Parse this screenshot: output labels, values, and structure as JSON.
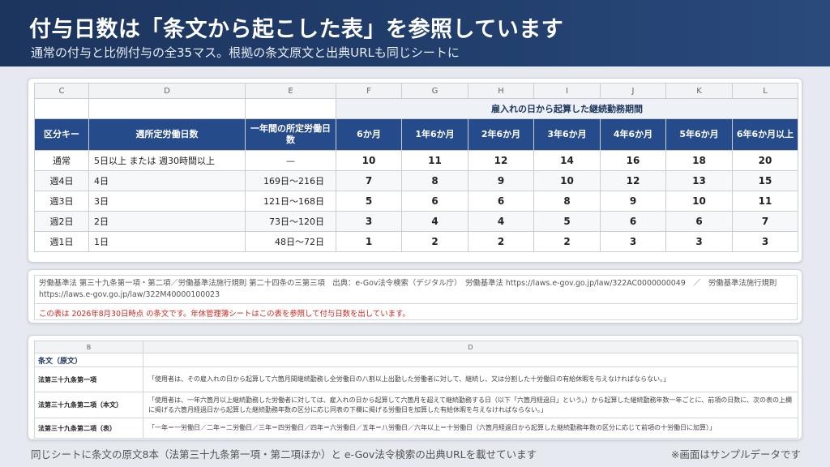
{
  "header": {
    "title": "付与日数は「条文から起こした表」を参照しています",
    "subtitle": "通常の付与と比例付与の全35マス。根拠の条文原文と出典URLも同じシートに"
  },
  "table": {
    "col_letters": [
      "C",
      "D",
      "E",
      "F",
      "G",
      "H",
      "I",
      "J",
      "K",
      "L"
    ],
    "group_header": "雇入れの日から起算した継続勤務期間",
    "headers": [
      "区分キー",
      "週所定労働日数",
      "一年間の所定労働日数",
      "6か月",
      "1年6か月",
      "2年6か月",
      "3年6か月",
      "4年6か月",
      "5年6か月",
      "6年6か月以上"
    ],
    "rows": [
      {
        "key": "通常",
        "days": "5日以上 または 週30時間以上",
        "annual": "—",
        "values": [
          "10",
          "11",
          "12",
          "14",
          "16",
          "18",
          "20"
        ]
      },
      {
        "key": "週4日",
        "days": "4日",
        "annual": "169日～216日",
        "values": [
          "7",
          "8",
          "9",
          "10",
          "12",
          "13",
          "15"
        ]
      },
      {
        "key": "週3日",
        "days": "3日",
        "annual": "121日～168日",
        "values": [
          "5",
          "6",
          "6",
          "8",
          "9",
          "10",
          "11"
        ]
      },
      {
        "key": "週2日",
        "days": "2日",
        "annual": "73日～120日",
        "values": [
          "3",
          "4",
          "4",
          "5",
          "6",
          "6",
          "7"
        ]
      },
      {
        "key": "週1日",
        "days": "1日",
        "annual": "48日～72日",
        "values": [
          "1",
          "2",
          "2",
          "2",
          "3",
          "3",
          "3"
        ]
      }
    ]
  },
  "source": {
    "text": "労働基準法 第三十九条第一項・第二項／労働基準法施行規則 第二十四条の三第三項　出典：e-Gov法令検索（デジタル庁）　労働基準法 https://laws.e-gov.go.jp/law/322AC0000000049　／　労働基準法施行規則 https://laws.e-gov.go.jp/law/322M40000100023",
    "note": "この表は 2026年8月30日時点 の条文です。年休管理簿シートはこの表を参照して付与日数を出しています。"
  },
  "law": {
    "col_letters": [
      "B",
      "D"
    ],
    "section_label": "条文（原文）",
    "rows": [
      {
        "title": "法第三十九条第一項",
        "text": "「使用者は、その雇入れの日から起算して六箇月間継続勤務し全労働日の八割以上出勤した労働者に対して、継続し、又は分割した十労働日の有給休暇を与えなければならない。」"
      },
      {
        "title": "法第三十九条第二項（本文）",
        "text": "「使用者は、一年六箇月以上継続勤務した労働者に対しては、雇入れの日から起算して六箇月を超えて継続勤務する日（以下「六箇月経過日」という。）から起算した継続勤務年数一年ごとに、前項の日数に、次の表の上欄に掲げる六箇月経過日から起算した継続勤務年数の区分に応じ同表の下欄に掲げる労働日を加算した有給休暇を与えなければならない。」"
      },
      {
        "title": "法第三十九条第二項（表）",
        "text": "「一年＝一労働日／二年＝二労働日／三年＝四労働日／四年＝六労働日／五年＝八労働日／六年以上＝十労働日（六箇月経過日から起算した継続勤務年数の区分に応じて前項の十労働日に加算）」"
      }
    ]
  },
  "footer": {
    "left": "同じシートに条文の原文8本（法第三十九条第一項・第二項ほか）と e-Gov法令検索の出典URLを載せています",
    "right": "※画面はサンプルデータです"
  }
}
